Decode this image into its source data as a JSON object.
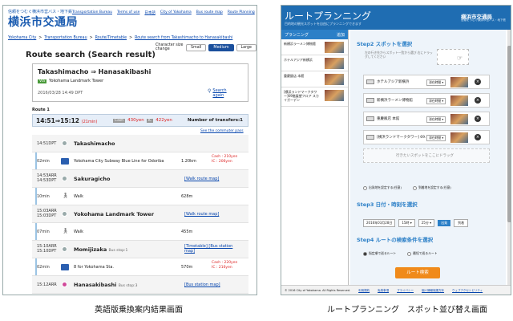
{
  "left": {
    "brand_small": "信頼をつむぐ横浜市営バス・地下鉄",
    "brand": "横浜市交通局",
    "top_links": [
      "Transportation Bureau",
      "Terms of use",
      "日本語",
      "City of Yokohama",
      "Bus route map",
      "Route Planning"
    ],
    "breadcrumbs": [
      "Yokohama City",
      ">",
      "Transportation Bureau",
      ">",
      "Route/Timetable",
      ">",
      "Route search from Takashimacho to Hanasakibashi"
    ],
    "size_label": "Character size change",
    "size_buttons": [
      "Small",
      "Medium",
      "Large"
    ],
    "page_title": "Route search (Search result)",
    "route_title": "Takashimacho ⇒ Hanasakibashi",
    "via_tag": "Via",
    "via_place": "Yokohama Landmark Tower",
    "search_date": "2016/03/28 14:49 DPT",
    "search_again": "Search again",
    "route_label": "Route 1",
    "summary_time": "14:51⇒15:12",
    "summary_dur": "(21min)",
    "cash_tag": "Cash",
    "cash_fare": "430yen",
    "ic_tag": "IC",
    "ic_fare": "422yen",
    "transfers": "Number of transfers:1",
    "commuter_link": "See the commuter pass",
    "rows": {
      "r1_time": "14:51DPT",
      "r1_name": "Takashimacho",
      "r2_time": "02min",
      "r2_mid": "Yokohama City Subway Blue Line  for Odoriba",
      "r2_dist": "1.20km",
      "r2_cash": "Cash : 210yen",
      "r2_ic": "IC : 206yen",
      "r3_time_a": "14:53ARR",
      "r3_time_b": "14:53DPT",
      "r3_name": "Sakuragicho",
      "r3_link": "[Walk route map]",
      "r4_time": "10min",
      "r4_mid": "Walk",
      "r4_dist": "628m",
      "r5_time_a": "15:03ARR",
      "r5_time_b": "15:03DPT",
      "r5_name": "Yokohama Landmark Tower",
      "r5_link": "[Walk route map]",
      "r6_time": "07min",
      "r6_mid": "Walk",
      "r6_dist": "455m",
      "r7_time_a": "15:10ARR",
      "r7_time_b": "15:10DPT",
      "r7_name": "Momijizaka",
      "r7_sub": "Bus stop:1",
      "r7_link": "[Timetable] [Bus station map]",
      "r8_time": "02min",
      "r8_mid": "8 for Yokohama Sta.",
      "r8_dist": "570m",
      "r8_cash": "Cash : 220yen",
      "r8_ic": "IC : 216yen",
      "r9_time": "15:12ARR",
      "r9_name": "Hanasakibashi",
      "r9_sub": "Bus stop:3",
      "r9_link": "[Bus station map]"
    }
  },
  "right": {
    "title": "ルートプランニング",
    "subtitle": "目的地の観光スポットを自由にプランニングできます",
    "brand": "横浜市交通局",
    "brand_sub": "信頼をつむぐ横浜市営バス・地下鉄",
    "sidebar_head": "プランニング",
    "sidebar_more": "追加",
    "sidebar_items": [
      "新横浜ラーメン博物館",
      "ホテルアジア新横浜",
      "重慶飯店 本館",
      "[横浜ランドマークタワー]69階展望フロア スカイガーデン"
    ],
    "step2": "Step2  スポットを選択",
    "step2_hint": "左の行き先からスポット一覧から選び 右にドラッグしてください",
    "spots": [
      {
        "name": "ホテルアジア新横浜",
        "sel": "滞在時間 ▾"
      },
      {
        "name": "新横浜ラーメン博物館",
        "sel": "滞在時間 ▾"
      },
      {
        "name": "重慶飯店 本館",
        "sel": "滞在時間 ▾"
      },
      {
        "name": "[横浜ランドマークタワー] 69…",
        "sel": "滞在時間 ▾"
      }
    ],
    "empty_slot": "行きたいスポットをここにドラッグ",
    "radio_a": "出発地を設定する(任意)",
    "radio_b": "到着地を設定する(任意)",
    "step3": "Step3  日付・時刻を選択",
    "date": "2016年03月28日",
    "hour": "15時 ▾",
    "minute": "25分 ▾",
    "btn_depart": "出発",
    "btn_arrive": "到着",
    "step4": "Step4  ルートの検索条件を選択",
    "opt_a": "指定順で巡るルート",
    "opt_b": "最短で巡るルート",
    "search_btn": "ルート検索",
    "footer_copy": "© 2016 City of Yokohama. All Rights Reserved.",
    "footer_links": [
      "利用規約",
      "免責事項",
      "プライバシー",
      "個人情報保護方針",
      "ウェブアクセシビリティ"
    ]
  },
  "captions": {
    "left": "英語版乗換案内結果画面",
    "right": "ルートプランニング　スポット並び替え画面"
  }
}
